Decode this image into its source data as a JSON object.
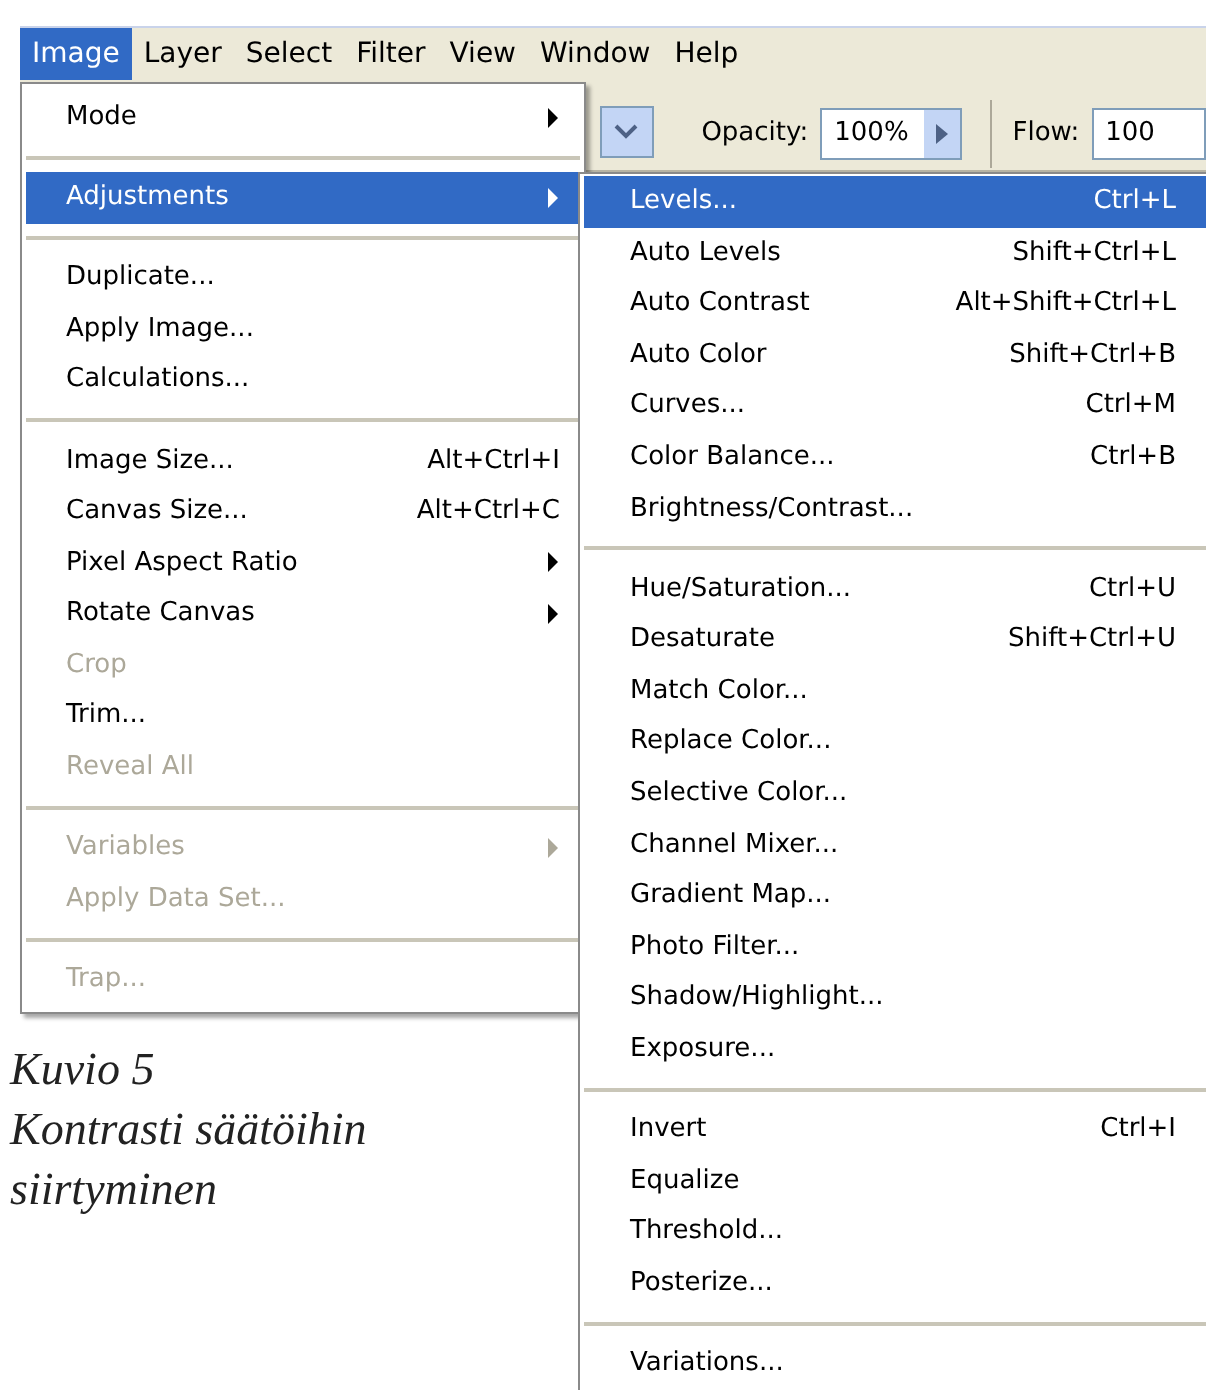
{
  "menubar": [
    {
      "label": "Image",
      "selected": true
    },
    {
      "label": "Layer",
      "selected": false
    },
    {
      "label": "Select",
      "selected": false
    },
    {
      "label": "Filter",
      "selected": false
    },
    {
      "label": "View",
      "selected": false
    },
    {
      "label": "Window",
      "selected": false
    },
    {
      "label": "Help",
      "selected": false
    }
  ],
  "toolbar": {
    "opacity_label": "Opacity:",
    "opacity_value": "100%",
    "flow_label": "Flow:",
    "flow_value": "100"
  },
  "image_menu": [
    {
      "kind": "item",
      "label": "Mode",
      "has_submenu": true,
      "disabled": false,
      "selected": false
    },
    {
      "kind": "separator"
    },
    {
      "kind": "item",
      "label": "Adjustments",
      "has_submenu": true,
      "disabled": false,
      "selected": true
    },
    {
      "kind": "separator"
    },
    {
      "kind": "item",
      "label": "Duplicate...",
      "has_submenu": false,
      "disabled": false,
      "selected": false
    },
    {
      "kind": "item",
      "label": "Apply Image...",
      "has_submenu": false,
      "disabled": false,
      "selected": false
    },
    {
      "kind": "item",
      "label": "Calculations...",
      "has_submenu": false,
      "disabled": false,
      "selected": false
    },
    {
      "kind": "separator"
    },
    {
      "kind": "item",
      "label": "Image Size...",
      "shortcut": "Alt+Ctrl+I",
      "has_submenu": false,
      "disabled": false,
      "selected": false
    },
    {
      "kind": "item",
      "label": "Canvas Size...",
      "shortcut": "Alt+Ctrl+C",
      "has_submenu": false,
      "disabled": false,
      "selected": false
    },
    {
      "kind": "item",
      "label": "Pixel Aspect Ratio",
      "has_submenu": true,
      "disabled": false,
      "selected": false
    },
    {
      "kind": "item",
      "label": "Rotate Canvas",
      "has_submenu": true,
      "disabled": false,
      "selected": false
    },
    {
      "kind": "item",
      "label": "Crop",
      "has_submenu": false,
      "disabled": true,
      "selected": false
    },
    {
      "kind": "item",
      "label": "Trim...",
      "has_submenu": false,
      "disabled": false,
      "selected": false
    },
    {
      "kind": "item",
      "label": "Reveal All",
      "has_submenu": false,
      "disabled": true,
      "selected": false
    },
    {
      "kind": "separator"
    },
    {
      "kind": "item",
      "label": "Variables",
      "has_submenu": true,
      "disabled": true,
      "selected": false
    },
    {
      "kind": "item",
      "label": "Apply Data Set...",
      "has_submenu": false,
      "disabled": true,
      "selected": false
    },
    {
      "kind": "separator"
    },
    {
      "kind": "item",
      "label": "Trap...",
      "has_submenu": false,
      "disabled": true,
      "selected": false
    }
  ],
  "adjustments_menu": [
    {
      "kind": "item",
      "label": "Levels...",
      "shortcut": "Ctrl+L",
      "selected": true
    },
    {
      "kind": "item",
      "label": "Auto Levels",
      "shortcut": "Shift+Ctrl+L",
      "selected": false
    },
    {
      "kind": "item",
      "label": "Auto Contrast",
      "shortcut": "Alt+Shift+Ctrl+L",
      "selected": false
    },
    {
      "kind": "item",
      "label": "Auto Color",
      "shortcut": "Shift+Ctrl+B",
      "selected": false
    },
    {
      "kind": "item",
      "label": "Curves...",
      "shortcut": "Ctrl+M",
      "selected": false
    },
    {
      "kind": "item",
      "label": "Color Balance...",
      "shortcut": "Ctrl+B",
      "selected": false
    },
    {
      "kind": "item",
      "label": "Brightness/Contrast...",
      "selected": false
    },
    {
      "kind": "separator"
    },
    {
      "kind": "item",
      "label": "Hue/Saturation...",
      "shortcut": "Ctrl+U",
      "selected": false
    },
    {
      "kind": "item",
      "label": "Desaturate",
      "shortcut": "Shift+Ctrl+U",
      "selected": false
    },
    {
      "kind": "item",
      "label": "Match Color...",
      "selected": false
    },
    {
      "kind": "item",
      "label": "Replace Color...",
      "selected": false
    },
    {
      "kind": "item",
      "label": "Selective Color...",
      "selected": false
    },
    {
      "kind": "item",
      "label": "Channel Mixer...",
      "selected": false
    },
    {
      "kind": "item",
      "label": "Gradient Map...",
      "selected": false
    },
    {
      "kind": "item",
      "label": "Photo Filter...",
      "selected": false
    },
    {
      "kind": "item",
      "label": "Shadow/Highlight...",
      "selected": false
    },
    {
      "kind": "item",
      "label": "Exposure...",
      "selected": false
    },
    {
      "kind": "separator"
    },
    {
      "kind": "item",
      "label": "Invert",
      "shortcut": "Ctrl+I",
      "selected": false
    },
    {
      "kind": "item",
      "label": "Equalize",
      "selected": false
    },
    {
      "kind": "item",
      "label": "Threshold...",
      "selected": false
    },
    {
      "kind": "item",
      "label": "Posterize...",
      "selected": false
    },
    {
      "kind": "separator"
    },
    {
      "kind": "item",
      "label": "Variations...",
      "selected": false
    }
  ],
  "caption": {
    "title": "Kuvio 5",
    "text": "Kontrasti säätöihin siirtyminen"
  }
}
